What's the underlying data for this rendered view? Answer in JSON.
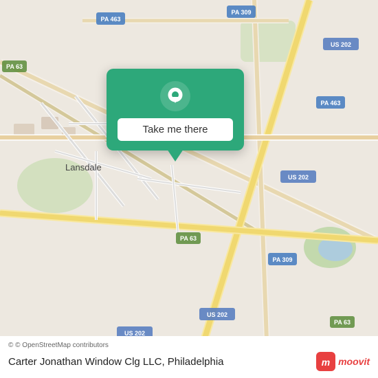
{
  "map": {
    "bg_color": "#ede8e0",
    "attribution": "© OpenStreetMap contributors",
    "location_label": "Carter Jonathan Window Clg LLC, Philadelphia",
    "moovit_label": "moovit"
  },
  "popup": {
    "button_label": "Take me there"
  },
  "route_labels": [
    {
      "id": "pa463_nw",
      "text": "PA 463"
    },
    {
      "id": "pa309_n",
      "text": "PA 309"
    },
    {
      "id": "us202_ne",
      "text": "US 202"
    },
    {
      "id": "pa463_e",
      "text": "PA 463"
    },
    {
      "id": "pa63_w",
      "text": "PA 63"
    },
    {
      "id": "lansdale",
      "text": "Lansdale"
    },
    {
      "id": "us202_mid",
      "text": "US 202"
    },
    {
      "id": "pa63_mid",
      "text": "PA 63"
    },
    {
      "id": "pa309_se",
      "text": "PA 309"
    },
    {
      "id": "us202_s",
      "text": "US 202"
    },
    {
      "id": "pa63_se",
      "text": "PA 63"
    }
  ]
}
